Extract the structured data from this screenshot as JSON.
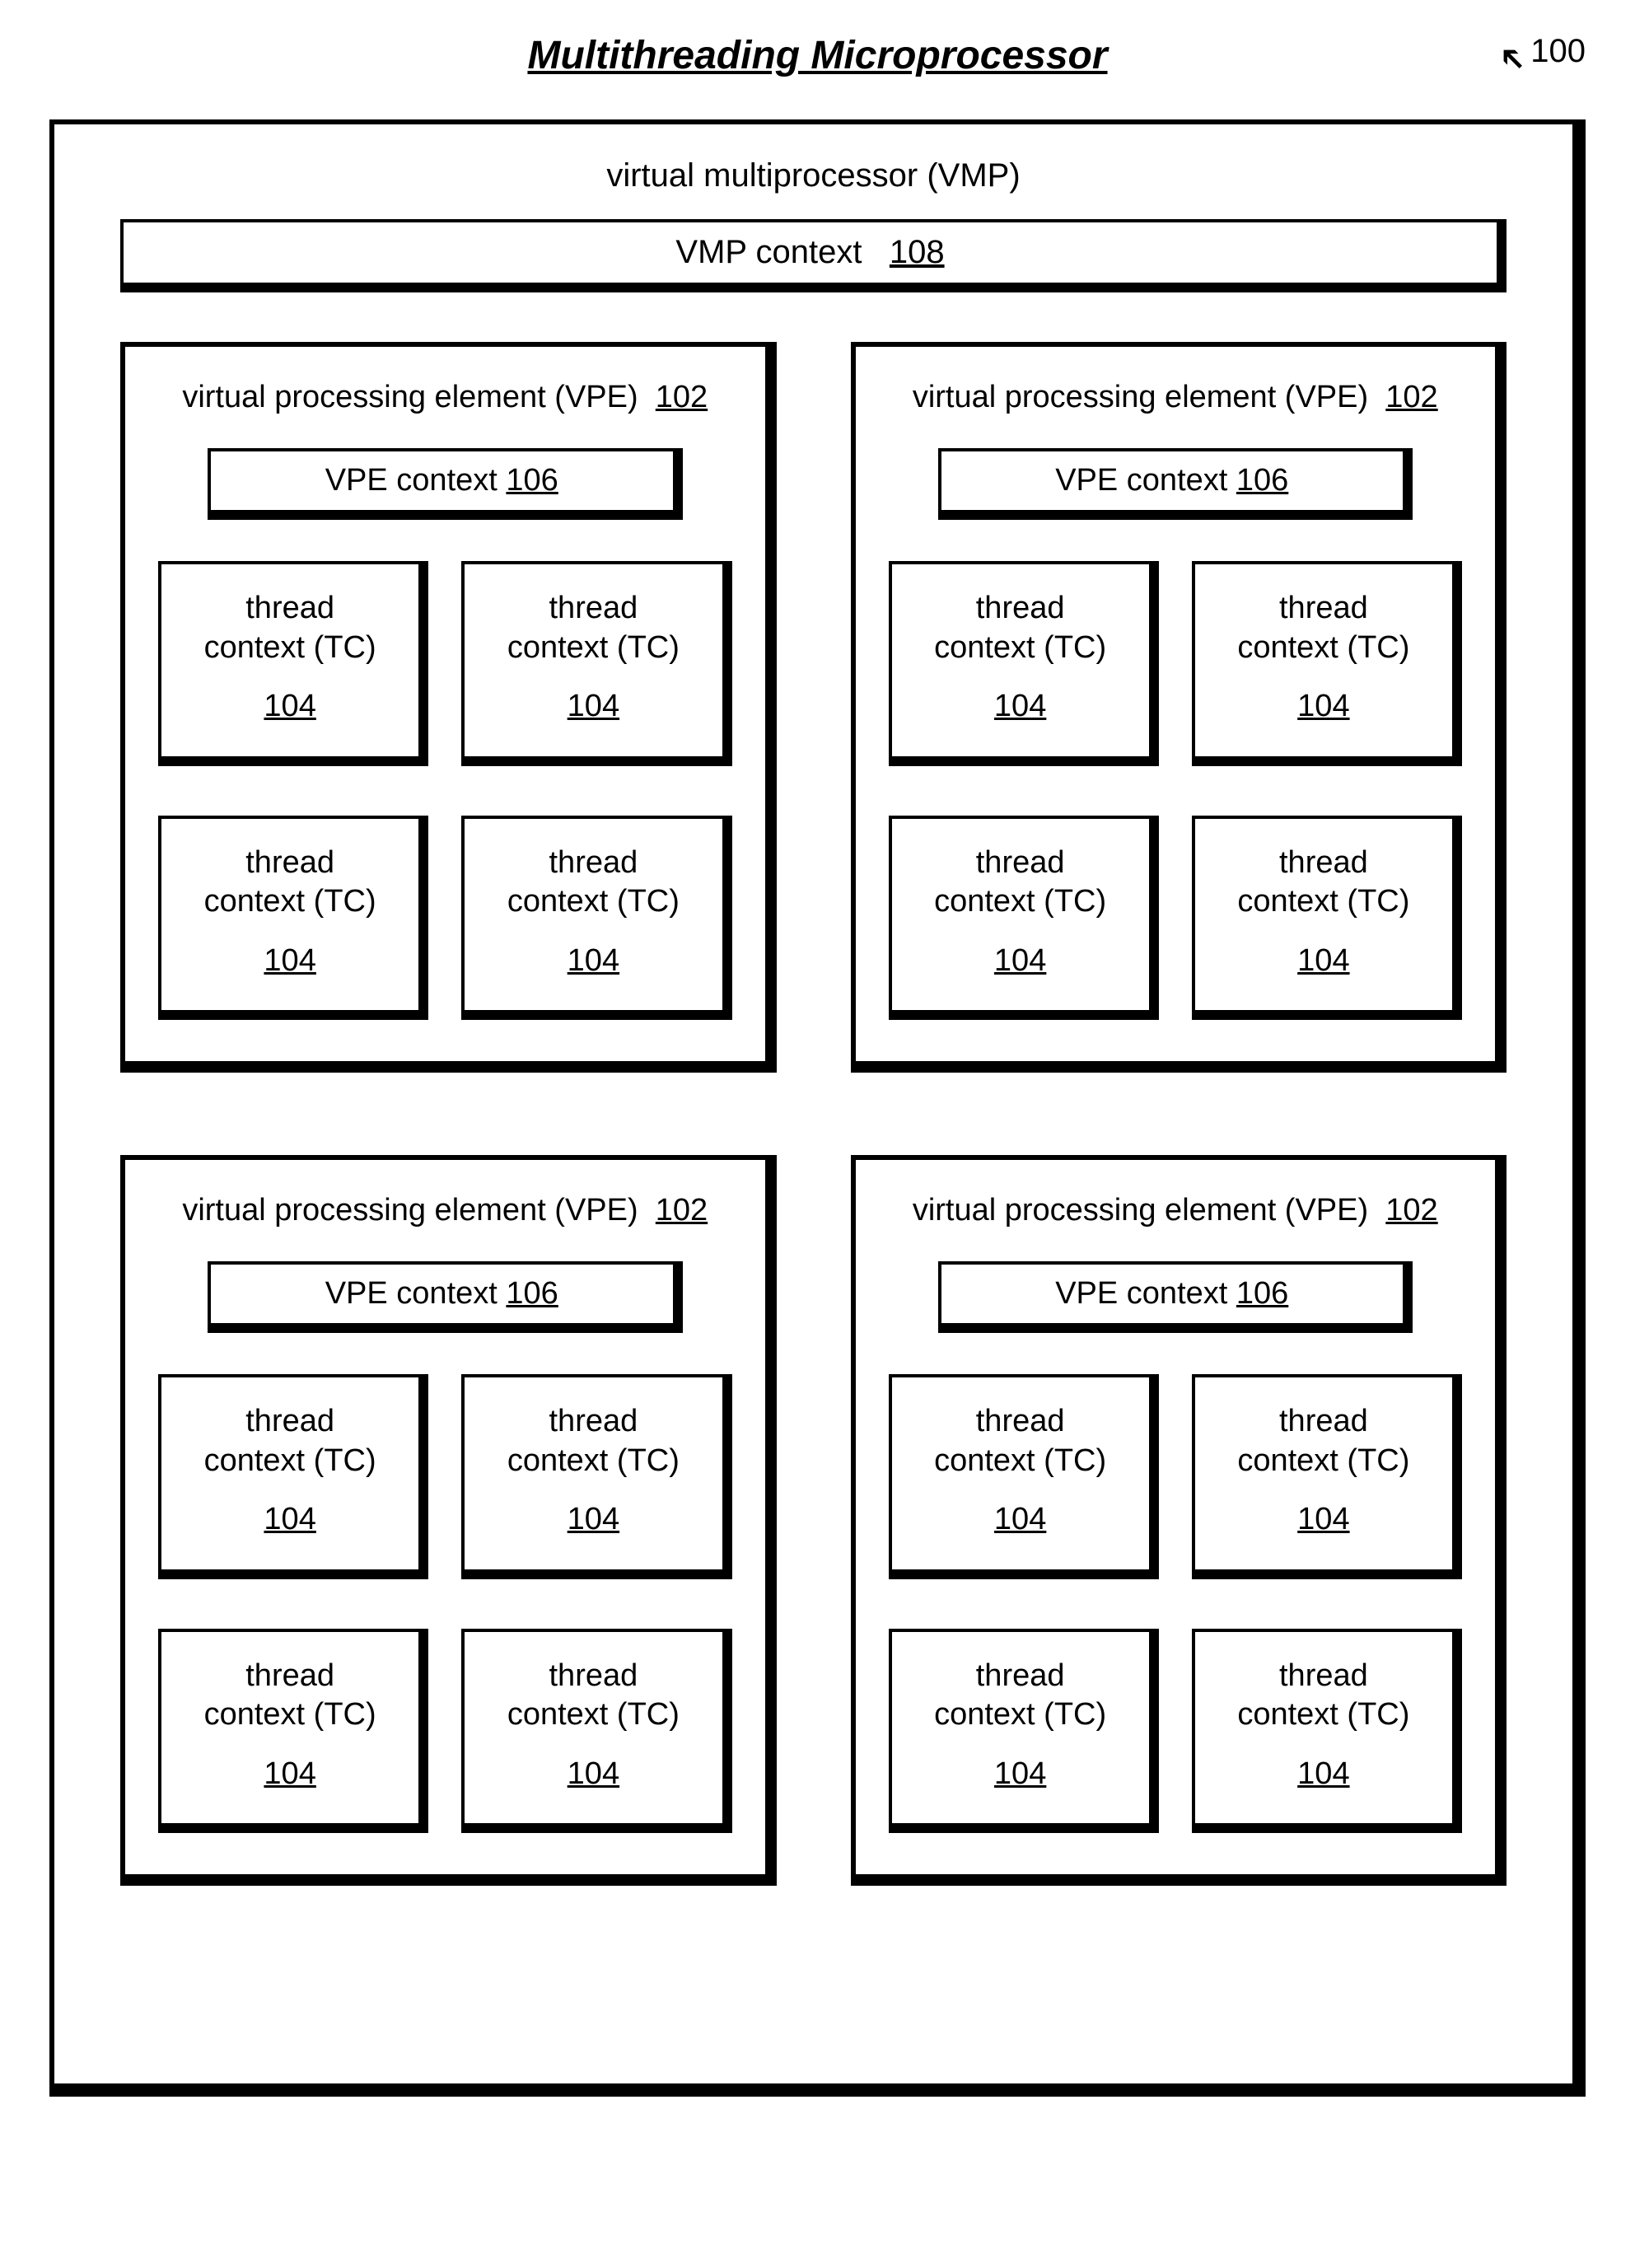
{
  "title": "Multithreading Microprocessor",
  "ref_outer": "100",
  "vmp": {
    "title": "virtual multiprocessor (VMP)",
    "context_label": "VMP context",
    "context_ref": "108"
  },
  "vpe": {
    "title_label": "virtual processing element (VPE)",
    "title_ref": "102",
    "context_label": "VPE context",
    "context_ref": "106"
  },
  "tc": {
    "line1": "thread",
    "line2": "context (TC)",
    "ref": "104"
  },
  "layout": {
    "vpe_count": 4,
    "tc_per_vpe": 4
  }
}
